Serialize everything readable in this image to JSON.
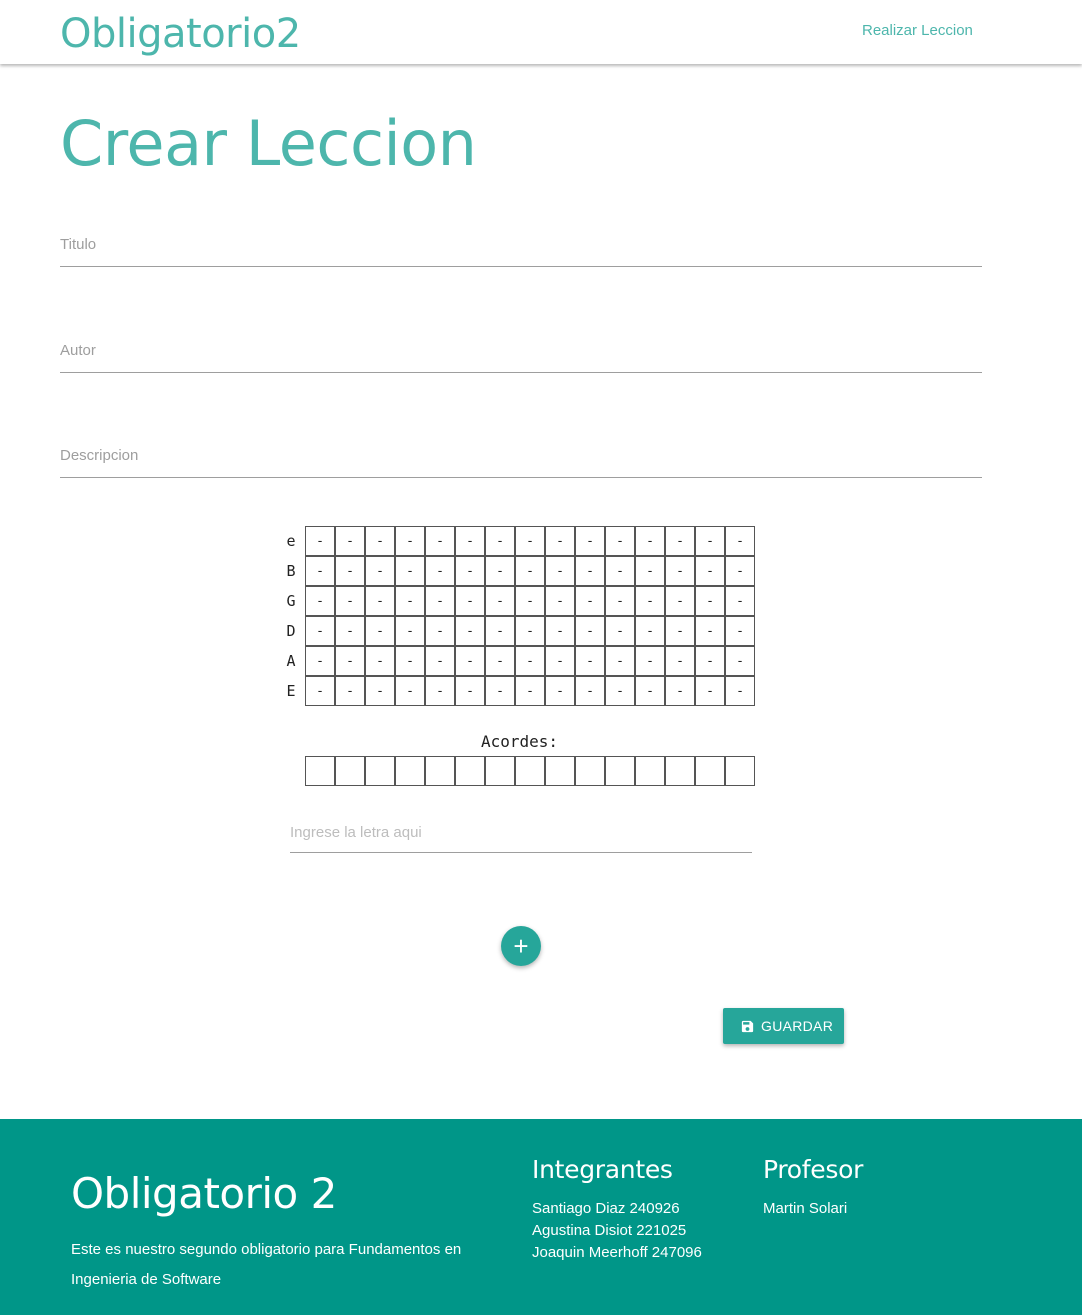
{
  "nav": {
    "brand": "Obligatorio2",
    "link": "Realizar Leccion"
  },
  "page": {
    "title": "Crear Leccion"
  },
  "form": {
    "titulo_label": "Titulo",
    "autor_label": "Autor",
    "descripcion_label": "Descripcion"
  },
  "tab": {
    "strings": [
      "e",
      "B",
      "G",
      "D",
      "A",
      "E"
    ],
    "columns": 15,
    "cell_value": "-"
  },
  "chords": {
    "label": "Acordes:",
    "columns": 15
  },
  "lyrics": {
    "placeholder": "Ingrese la letra aqui"
  },
  "buttons": {
    "add_icon": "plus-icon",
    "save_icon": "save-icon",
    "save_label": "GUARDAR"
  },
  "footer": {
    "title": "Obligatorio 2",
    "description": "Este es nuestro segundo obligatorio para Fundamentos en Ingenieria de Software",
    "integrantes_heading": "Integrantes",
    "integrantes": [
      "Santiago Diaz 240926",
      "Agustina Disiot 221025",
      "Joaquin Meerhoff 247096"
    ],
    "profesor_heading": "Profesor",
    "profesor": "Martin Solari"
  },
  "colors": {
    "accent": "#4db6ac",
    "button": "#26a69a",
    "footer": "#009688"
  }
}
